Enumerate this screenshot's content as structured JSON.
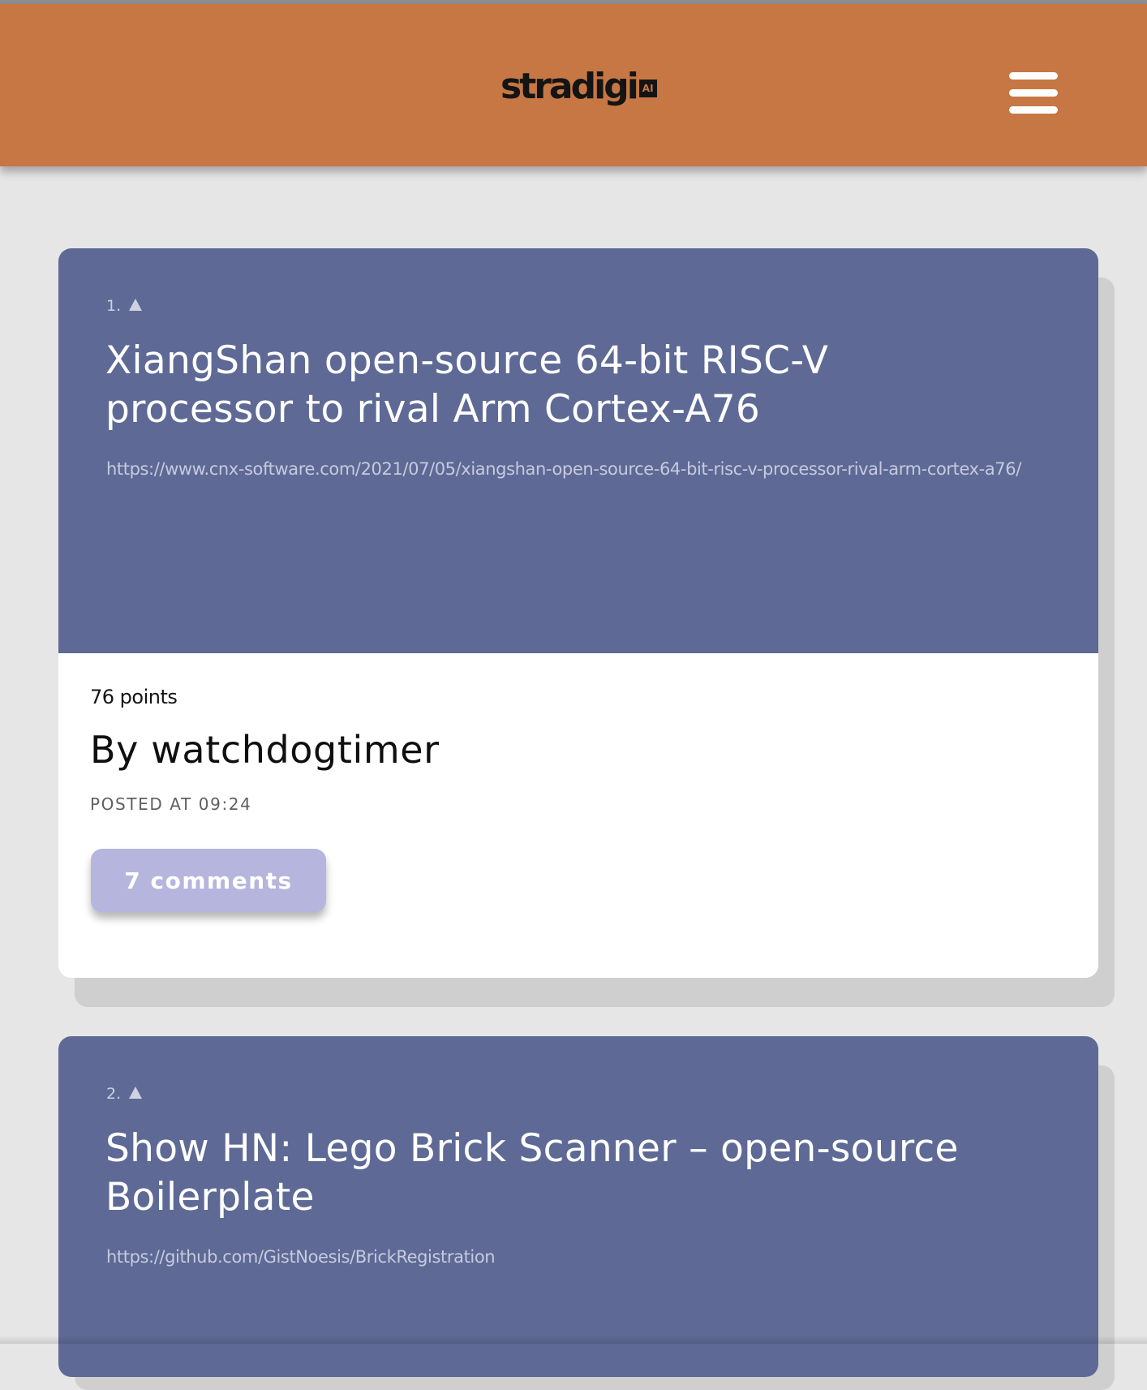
{
  "header": {
    "logo_text": "stradigi",
    "logo_badge": "AI",
    "brand_color": "#c67743",
    "menu_icon": "hamburger-menu-icon"
  },
  "colors": {
    "card_top": "#5e6a95",
    "card_bottom": "#ffffff",
    "page_background": "#e6e6e6",
    "comments_button": "#b5b5dd"
  },
  "stories": [
    {
      "rank": "1.",
      "upvote_icon": "upvote-triangle-icon",
      "title": "XiangShan open-source 64-bit RISC-V processor to rival Arm Cortex-A76",
      "url": "https://www.cnx-software.com/2021/07/05/xiangshan-open-source-64-bit-risc-v-processor-rival-arm-cortex-a76/",
      "points": "76 points",
      "author": "By watchdogtimer",
      "posted": "POSTED AT 09:24",
      "comments": "7 comments"
    },
    {
      "rank": "2.",
      "upvote_icon": "upvote-triangle-icon",
      "title": "Show HN: Lego Brick Scanner – open-source Boilerplate",
      "url": "https://github.com/GistNoesis/BrickRegistration"
    }
  ]
}
